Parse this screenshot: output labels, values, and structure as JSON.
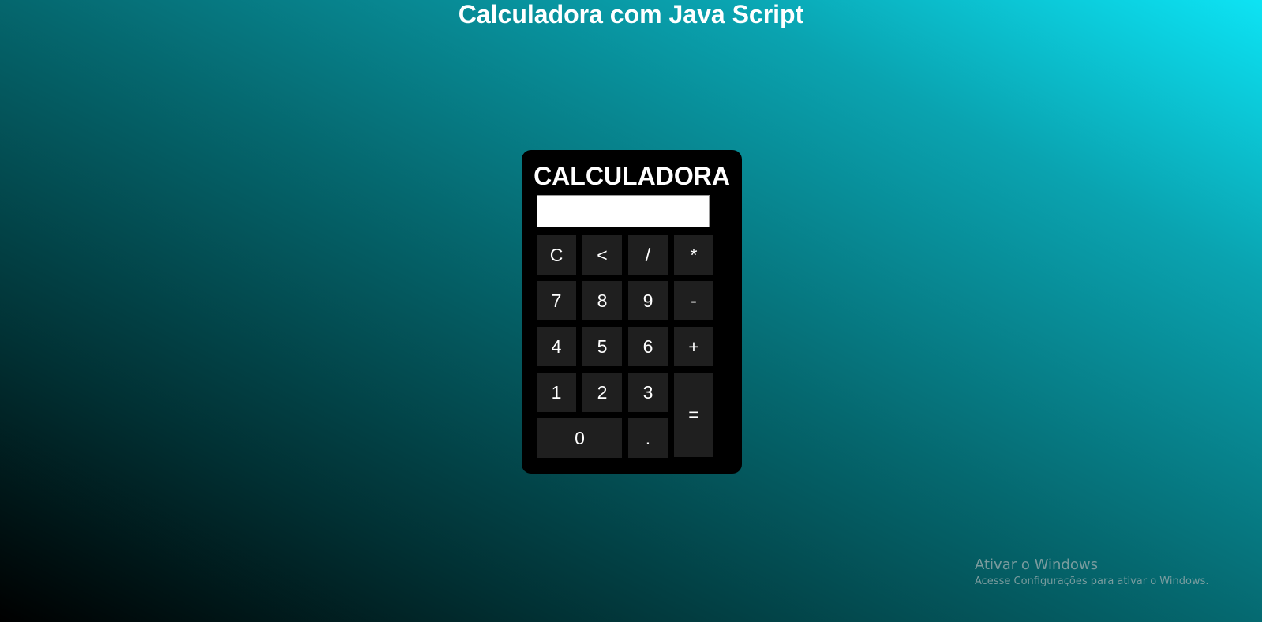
{
  "page": {
    "title": "Calculadora com Java Script"
  },
  "calculator": {
    "heading": "CALCULADORA",
    "display_value": "",
    "keys": {
      "clear": "C",
      "backspace": "<",
      "divide": "/",
      "multiply": "*",
      "seven": "7",
      "eight": "8",
      "nine": "9",
      "subtract": "-",
      "four": "4",
      "five": "5",
      "six": "6",
      "add": "+",
      "one": "1",
      "two": "2",
      "three": "3",
      "equals": "=",
      "zero": "0",
      "decimal": "."
    }
  },
  "watermark": {
    "title": "Ativar o Windows",
    "subtitle": "Acesse Configurações para ativar o Windows."
  },
  "colors": {
    "background_start": "#000000",
    "background_end": "#0de3f4",
    "calculator_body": "#000000",
    "key_background": "#1f1f1f",
    "key_text": "#ffffff"
  }
}
